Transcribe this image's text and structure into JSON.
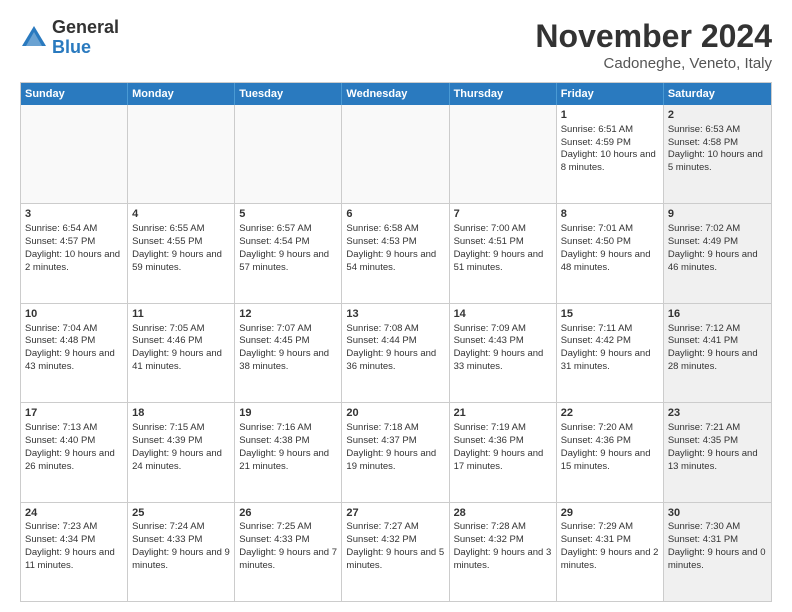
{
  "logo": {
    "general": "General",
    "blue": "Blue"
  },
  "header": {
    "month": "November 2024",
    "location": "Cadoneghe, Veneto, Italy"
  },
  "weekdays": [
    "Sunday",
    "Monday",
    "Tuesday",
    "Wednesday",
    "Thursday",
    "Friday",
    "Saturday"
  ],
  "rows": [
    [
      {
        "day": "",
        "info": "",
        "shaded": false,
        "empty": true
      },
      {
        "day": "",
        "info": "",
        "shaded": false,
        "empty": true
      },
      {
        "day": "",
        "info": "",
        "shaded": false,
        "empty": true
      },
      {
        "day": "",
        "info": "",
        "shaded": false,
        "empty": true
      },
      {
        "day": "",
        "info": "",
        "shaded": false,
        "empty": true
      },
      {
        "day": "1",
        "info": "Sunrise: 6:51 AM\nSunset: 4:59 PM\nDaylight: 10 hours and 8 minutes.",
        "shaded": false,
        "empty": false
      },
      {
        "day": "2",
        "info": "Sunrise: 6:53 AM\nSunset: 4:58 PM\nDaylight: 10 hours and 5 minutes.",
        "shaded": true,
        "empty": false
      }
    ],
    [
      {
        "day": "3",
        "info": "Sunrise: 6:54 AM\nSunset: 4:57 PM\nDaylight: 10 hours and 2 minutes.",
        "shaded": false,
        "empty": false
      },
      {
        "day": "4",
        "info": "Sunrise: 6:55 AM\nSunset: 4:55 PM\nDaylight: 9 hours and 59 minutes.",
        "shaded": false,
        "empty": false
      },
      {
        "day": "5",
        "info": "Sunrise: 6:57 AM\nSunset: 4:54 PM\nDaylight: 9 hours and 57 minutes.",
        "shaded": false,
        "empty": false
      },
      {
        "day": "6",
        "info": "Sunrise: 6:58 AM\nSunset: 4:53 PM\nDaylight: 9 hours and 54 minutes.",
        "shaded": false,
        "empty": false
      },
      {
        "day": "7",
        "info": "Sunrise: 7:00 AM\nSunset: 4:51 PM\nDaylight: 9 hours and 51 minutes.",
        "shaded": false,
        "empty": false
      },
      {
        "day": "8",
        "info": "Sunrise: 7:01 AM\nSunset: 4:50 PM\nDaylight: 9 hours and 48 minutes.",
        "shaded": false,
        "empty": false
      },
      {
        "day": "9",
        "info": "Sunrise: 7:02 AM\nSunset: 4:49 PM\nDaylight: 9 hours and 46 minutes.",
        "shaded": true,
        "empty": false
      }
    ],
    [
      {
        "day": "10",
        "info": "Sunrise: 7:04 AM\nSunset: 4:48 PM\nDaylight: 9 hours and 43 minutes.",
        "shaded": false,
        "empty": false
      },
      {
        "day": "11",
        "info": "Sunrise: 7:05 AM\nSunset: 4:46 PM\nDaylight: 9 hours and 41 minutes.",
        "shaded": false,
        "empty": false
      },
      {
        "day": "12",
        "info": "Sunrise: 7:07 AM\nSunset: 4:45 PM\nDaylight: 9 hours and 38 minutes.",
        "shaded": false,
        "empty": false
      },
      {
        "day": "13",
        "info": "Sunrise: 7:08 AM\nSunset: 4:44 PM\nDaylight: 9 hours and 36 minutes.",
        "shaded": false,
        "empty": false
      },
      {
        "day": "14",
        "info": "Sunrise: 7:09 AM\nSunset: 4:43 PM\nDaylight: 9 hours and 33 minutes.",
        "shaded": false,
        "empty": false
      },
      {
        "day": "15",
        "info": "Sunrise: 7:11 AM\nSunset: 4:42 PM\nDaylight: 9 hours and 31 minutes.",
        "shaded": false,
        "empty": false
      },
      {
        "day": "16",
        "info": "Sunrise: 7:12 AM\nSunset: 4:41 PM\nDaylight: 9 hours and 28 minutes.",
        "shaded": true,
        "empty": false
      }
    ],
    [
      {
        "day": "17",
        "info": "Sunrise: 7:13 AM\nSunset: 4:40 PM\nDaylight: 9 hours and 26 minutes.",
        "shaded": false,
        "empty": false
      },
      {
        "day": "18",
        "info": "Sunrise: 7:15 AM\nSunset: 4:39 PM\nDaylight: 9 hours and 24 minutes.",
        "shaded": false,
        "empty": false
      },
      {
        "day": "19",
        "info": "Sunrise: 7:16 AM\nSunset: 4:38 PM\nDaylight: 9 hours and 21 minutes.",
        "shaded": false,
        "empty": false
      },
      {
        "day": "20",
        "info": "Sunrise: 7:18 AM\nSunset: 4:37 PM\nDaylight: 9 hours and 19 minutes.",
        "shaded": false,
        "empty": false
      },
      {
        "day": "21",
        "info": "Sunrise: 7:19 AM\nSunset: 4:36 PM\nDaylight: 9 hours and 17 minutes.",
        "shaded": false,
        "empty": false
      },
      {
        "day": "22",
        "info": "Sunrise: 7:20 AM\nSunset: 4:36 PM\nDaylight: 9 hours and 15 minutes.",
        "shaded": false,
        "empty": false
      },
      {
        "day": "23",
        "info": "Sunrise: 7:21 AM\nSunset: 4:35 PM\nDaylight: 9 hours and 13 minutes.",
        "shaded": true,
        "empty": false
      }
    ],
    [
      {
        "day": "24",
        "info": "Sunrise: 7:23 AM\nSunset: 4:34 PM\nDaylight: 9 hours and 11 minutes.",
        "shaded": false,
        "empty": false
      },
      {
        "day": "25",
        "info": "Sunrise: 7:24 AM\nSunset: 4:33 PM\nDaylight: 9 hours and 9 minutes.",
        "shaded": false,
        "empty": false
      },
      {
        "day": "26",
        "info": "Sunrise: 7:25 AM\nSunset: 4:33 PM\nDaylight: 9 hours and 7 minutes.",
        "shaded": false,
        "empty": false
      },
      {
        "day": "27",
        "info": "Sunrise: 7:27 AM\nSunset: 4:32 PM\nDaylight: 9 hours and 5 minutes.",
        "shaded": false,
        "empty": false
      },
      {
        "day": "28",
        "info": "Sunrise: 7:28 AM\nSunset: 4:32 PM\nDaylight: 9 hours and 3 minutes.",
        "shaded": false,
        "empty": false
      },
      {
        "day": "29",
        "info": "Sunrise: 7:29 AM\nSunset: 4:31 PM\nDaylight: 9 hours and 2 minutes.",
        "shaded": false,
        "empty": false
      },
      {
        "day": "30",
        "info": "Sunrise: 7:30 AM\nSunset: 4:31 PM\nDaylight: 9 hours and 0 minutes.",
        "shaded": true,
        "empty": false
      }
    ]
  ]
}
